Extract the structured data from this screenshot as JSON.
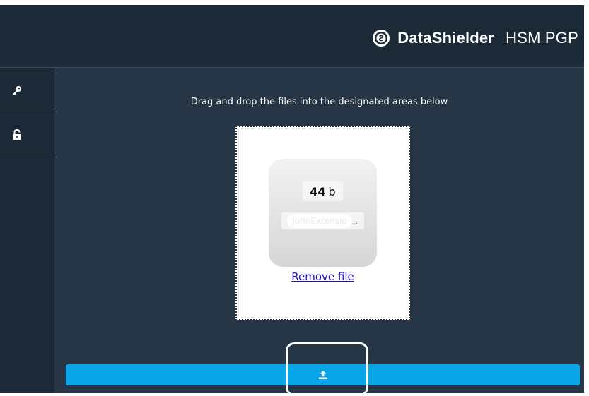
{
  "header": {
    "brand_bold": "DataShielder",
    "brand_light": "HSM PGP",
    "logo_icon": "shield-lock-icon"
  },
  "sidebar": {
    "items": [
      {
        "icon": "key-icon"
      },
      {
        "icon": "unlock-icon"
      }
    ]
  },
  "main": {
    "instruction": "Drag and drop the files into the designated areas below",
    "file": {
      "size_value": "44",
      "size_unit": "b",
      "name": "JohnExtensio",
      "name_ellipsis": ".."
    },
    "remove_label": "Remove file",
    "upload_icon": "upload-icon"
  },
  "colors": {
    "background": "#1c2a38",
    "main_panel": "#263646",
    "accent": "#0aa4e8",
    "link": "#1a0dcc"
  }
}
